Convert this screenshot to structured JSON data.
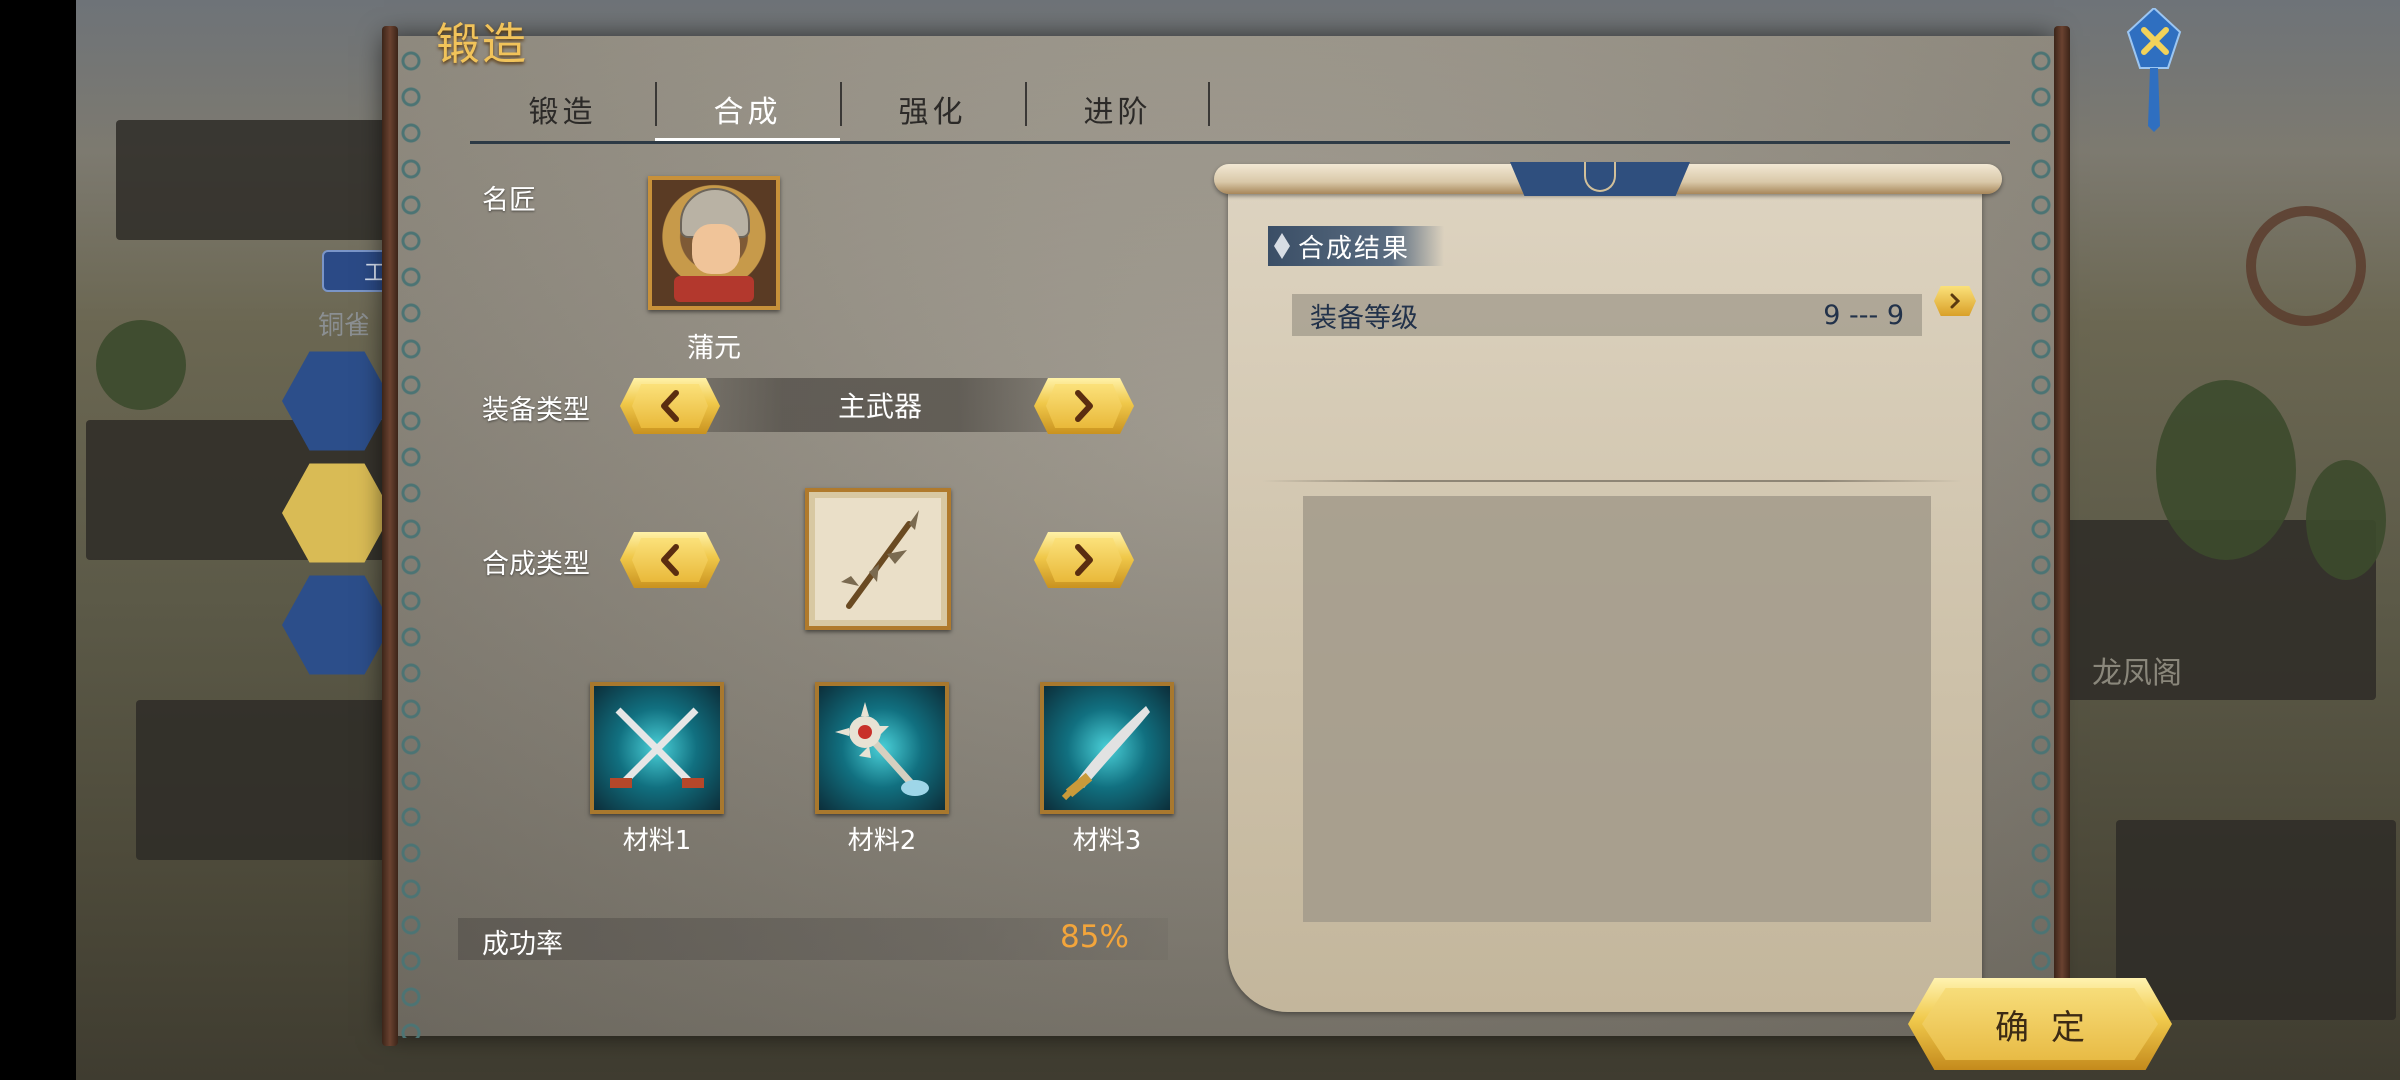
{
  "window": {
    "title": "锻造"
  },
  "tabs": [
    {
      "label": "锻造",
      "active": false
    },
    {
      "label": "合成",
      "active": true
    },
    {
      "label": "强化",
      "active": false
    },
    {
      "label": "进阶",
      "active": false
    }
  ],
  "craftsman": {
    "label": "名匠",
    "name": "蒲元"
  },
  "equip_type": {
    "label": "装备类型",
    "value": "主武器"
  },
  "synth_type": {
    "label": "合成类型",
    "icon": "halberd-icon"
  },
  "materials": [
    {
      "name": "材料1",
      "icon": "crossed-swords-icon"
    },
    {
      "name": "材料2",
      "icon": "spiked-mace-icon"
    },
    {
      "name": "材料3",
      "icon": "dragon-blade-icon"
    }
  ],
  "success_rate": {
    "label": "成功率",
    "value": "85%"
  },
  "result": {
    "title": "合成结果",
    "equip_level_label": "装备等级",
    "equip_level_value": "9 --- 9"
  },
  "confirm_label": "确定",
  "background": {
    "building_label": "龙凤阁",
    "chip_label": "工",
    "side_text": "铜雀"
  },
  "colors": {
    "title_gold": "#f1c35a",
    "success_orange": "#f3a53b",
    "result_text": "#22324a"
  }
}
